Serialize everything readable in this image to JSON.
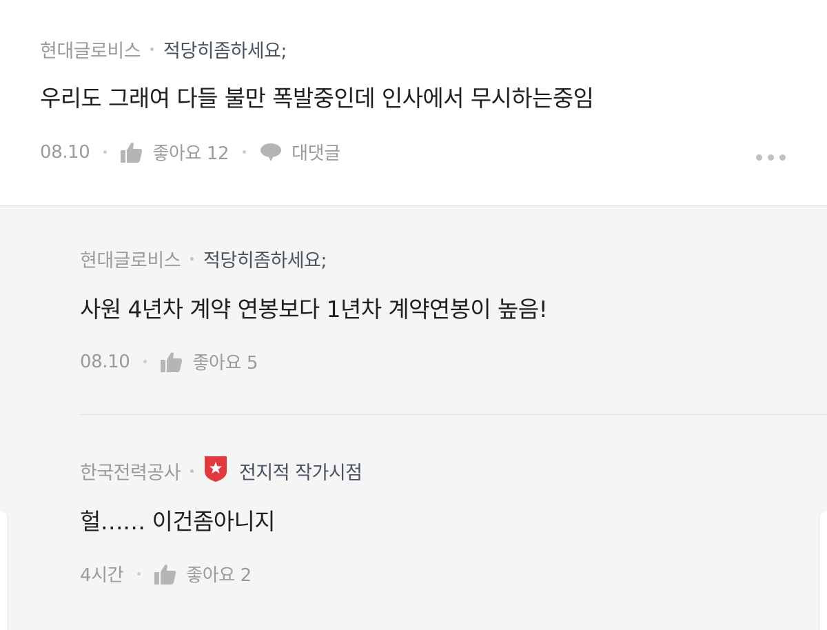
{
  "comments": [
    {
      "company": "현대글로비스",
      "nickname": "적당히좀하세요;",
      "text": "우리도 그래여 다들 불만 폭발중인데 인사에서 무시하는중임",
      "date": "08.10",
      "like_label": "좋아요 12",
      "reply_label": "대댓글"
    }
  ],
  "replies": [
    {
      "company": "현대글로비스",
      "nickname": "적당히좀하세요;",
      "text": "사원 4년차 계약 연봉보다 1년차 계약연봉이 높음!",
      "date": "08.10",
      "like_label": "좋아요 5"
    },
    {
      "company": "한국전력공사",
      "nickname": "전지적 작가시점",
      "badge_icon": "star-shield-icon",
      "badge_color": "#e0393e",
      "text": "헐…… 이건좀아니지",
      "date": "4시간",
      "like_label": "좋아요 2"
    }
  ],
  "colors": {
    "meta": "#9b9b9b",
    "nickname": "#4a5360",
    "body": "#1f1f1f",
    "reply_bg": "#f5f5f5"
  }
}
